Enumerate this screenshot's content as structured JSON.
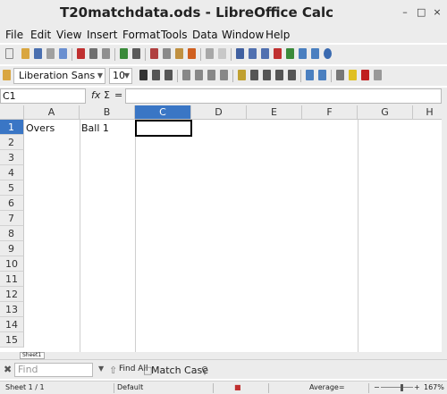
{
  "window": {
    "title": "T20matchdata.ods - LibreOffice Calc",
    "minimize": "–",
    "maximize": "□",
    "close": "×"
  },
  "menu": [
    "File",
    "Edit",
    "View",
    "Insert",
    "Format",
    "Tools",
    "Data",
    "Window",
    "Help"
  ],
  "format_toolbar": {
    "font_name": "Liberation Sans",
    "font_size": "10"
  },
  "formula_bar": {
    "cell_ref": "C1",
    "function_wizard": "fx",
    "sum_symbol": "Σ",
    "equals_symbol": "=",
    "content": ""
  },
  "columns": [
    "A",
    "B",
    "C",
    "D",
    "E",
    "F",
    "G",
    "H"
  ],
  "selected_column": "C",
  "rows": [
    "1",
    "2",
    "3",
    "4",
    "5",
    "6",
    "7",
    "8",
    "9",
    "10",
    "11",
    "12",
    "13",
    "14",
    "15"
  ],
  "selected_row": "1",
  "cells": {
    "A1": "Overs",
    "B1": "Ball 1",
    "C1": ""
  },
  "sheet_tabs": [
    "Sheet1"
  ],
  "find_bar": {
    "placeholder": "Find",
    "find_all": "Find All",
    "match_case": "Match Case"
  },
  "status_bar": {
    "sheet": "Sheet 1 / 1",
    "page_style": "Default",
    "average": "Average=",
    "zoom": "167%"
  }
}
